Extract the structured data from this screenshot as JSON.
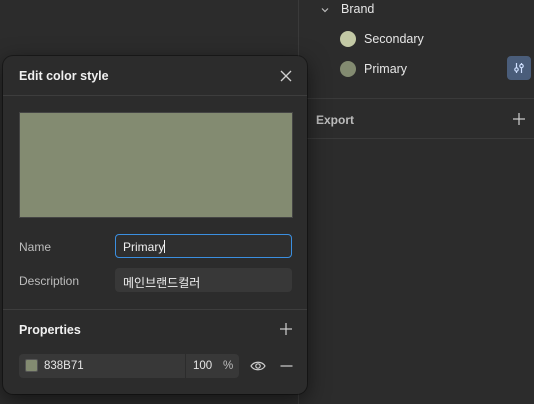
{
  "styles_panel": {
    "group_label": "Brand",
    "items": [
      {
        "label": "Secondary",
        "color": "#c3c9a5"
      },
      {
        "label": "Primary",
        "color": "#838b71"
      }
    ],
    "export_label": "Export"
  },
  "dialog": {
    "title": "Edit color style",
    "preview_color": "#838b71",
    "name_label": "Name",
    "name_value": "Primary",
    "description_label": "Description",
    "description_value": "메인브랜드컬러",
    "properties_label": "Properties",
    "fill": {
      "hex": "838B71",
      "swatch_color": "#838b71",
      "opacity": "100",
      "opacity_unit": "%"
    }
  },
  "colors": {
    "accent_focus": "#3b8fe0",
    "adjust_button_bg": "#4a5d7a"
  }
}
